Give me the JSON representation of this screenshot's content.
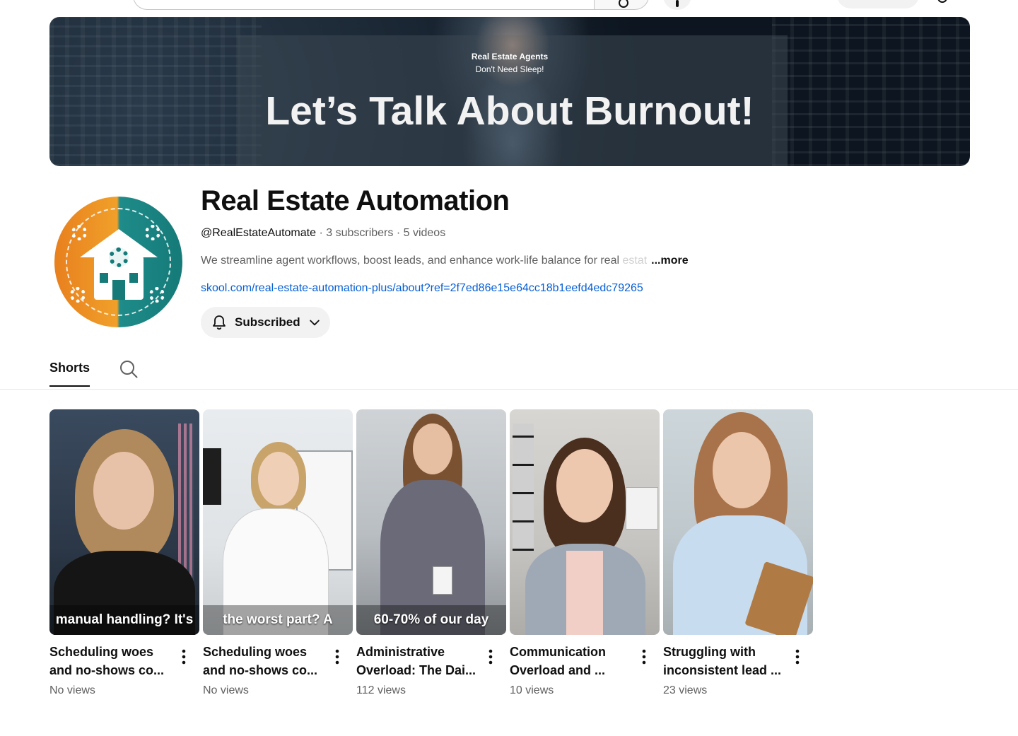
{
  "banner": {
    "tagline_1": "Real Estate Agents",
    "tagline_2": "Don't Need Sleep!",
    "headline": "Let’s Talk About Burnout!"
  },
  "channel": {
    "name": "Real Estate Automation",
    "handle": "@RealEstateAutomate",
    "meta_separator_1": " · ",
    "subscribers": "3 subscribers",
    "meta_separator_2": " · ",
    "videos": "5 videos",
    "description": "We streamline agent workflows, boost leads, and enhance work-life balance for real ",
    "description_faded": "estat",
    "more_label": "...more",
    "link": "skool.com/real-estate-automation-plus/about?ref=2f7ed86e15e64cc18b1eefd4edc79265",
    "subscribe_label": "Subscribed"
  },
  "tabs": {
    "shorts_label": "Shorts"
  },
  "shorts": [
    {
      "caption": "manual handling? It's",
      "title_line1": "Scheduling woes",
      "title_line2": "and no-shows co...",
      "views": "No views"
    },
    {
      "caption": "the worst part? A",
      "title_line1": "Scheduling woes",
      "title_line2": "and no-shows co...",
      "views": "No views"
    },
    {
      "caption": "60-70% of our day",
      "title_line1": "Administrative",
      "title_line2": "Overload: The Dai...",
      "views": "112 views"
    },
    {
      "caption": "",
      "title_line1": "Communication",
      "title_line2": "Overload and ...",
      "views": "10 views"
    },
    {
      "caption": "",
      "title_line1": "Struggling with",
      "title_line2": "inconsistent lead ...",
      "views": "23 views"
    }
  ],
  "colors": {
    "link": "#065fd4",
    "avatar_orange": "#e8801e",
    "avatar_teal": "#157a78"
  },
  "icons": {
    "subscribe_bell": "bell-icon",
    "subscribe_chevron": "chevron-down-icon",
    "tab_search": "search-icon",
    "card_menu": "more-vert-icon"
  }
}
